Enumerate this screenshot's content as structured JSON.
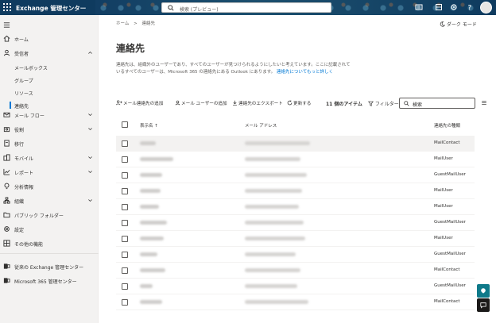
{
  "header": {
    "app_title": "Exchange 管理センター",
    "search_placeholder": "検索 (プレビュー)"
  },
  "sidebar": {
    "items": [
      {
        "label": "ホーム"
      },
      {
        "label": "受信者"
      },
      {
        "label": "メールボックス"
      },
      {
        "label": "グループ"
      },
      {
        "label": "リソース"
      },
      {
        "label": "連絡先"
      },
      {
        "label": "メール フロー"
      },
      {
        "label": "役割"
      },
      {
        "label": "移行"
      },
      {
        "label": "モバイル"
      },
      {
        "label": "レポート"
      },
      {
        "label": "分析情報"
      },
      {
        "label": "組織"
      },
      {
        "label": "パブリック フォルダー"
      },
      {
        "label": "設定"
      },
      {
        "label": "その他の機能"
      },
      {
        "label": "従来の Exchange 管理センター"
      },
      {
        "label": "Microsoft 365 管理センター"
      }
    ]
  },
  "main": {
    "breadcrumb_home": "ホーム",
    "breadcrumb_sep": ">",
    "breadcrumb_current": "連絡先",
    "dark_mode_label": "ダーク モード",
    "title": "連絡先",
    "description": "連絡先は、組織外のユーザーであり、すべてのユーザーが見つけられるようにしたいと考えています。ここに記載されているすべてのユーザーは、Microsoft 365 の連絡先にある Outlook にあります。",
    "description_link": "連絡先についてもっと詳しく"
  },
  "toolbar": {
    "add_mail_contact": "メール連絡先の追加",
    "add_mail_user": "メール ユーザーの追加",
    "export_contacts": "連絡先のエクスポート",
    "refresh": "更新する",
    "item_count": "11 個のアイテム",
    "filter": "フィルター",
    "search_placeholder": "検索"
  },
  "table": {
    "columns": [
      "表示名 ↑",
      "メール アドレス",
      "連絡先の種類"
    ],
    "rows": [
      {
        "type": "MailContact"
      },
      {
        "type": "MailUser"
      },
      {
        "type": "GuestMailUser"
      },
      {
        "type": "MailUser"
      },
      {
        "type": "MailUser"
      },
      {
        "type": "GuestMailUser"
      },
      {
        "type": "MailUser"
      },
      {
        "type": "GuestMailUser"
      },
      {
        "type": "MailContact"
      },
      {
        "type": "GuestMailUser"
      },
      {
        "type": "MailContact"
      }
    ]
  }
}
